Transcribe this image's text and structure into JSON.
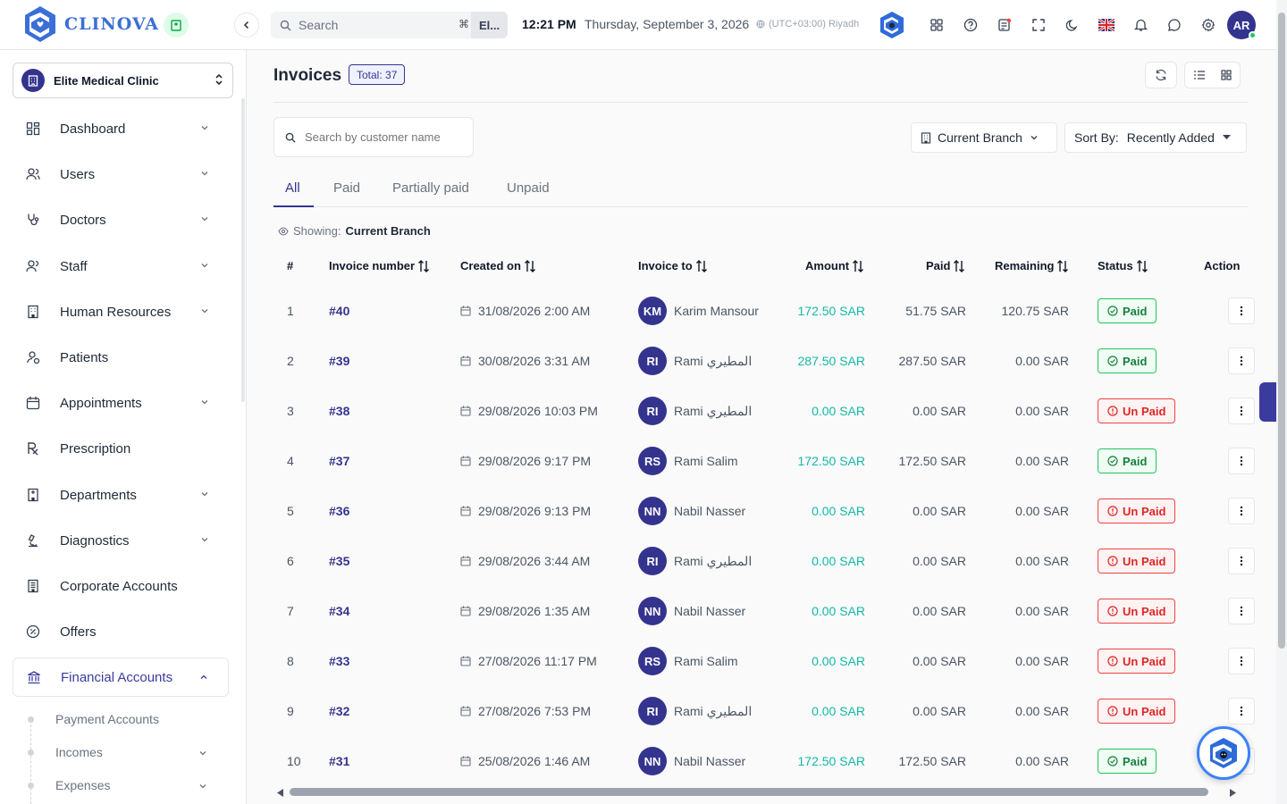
{
  "app": {
    "name": "CLINOVA"
  },
  "topbar": {
    "search_placeholder": "Search",
    "search_shortcut": "⌘",
    "workspace_short": "El...",
    "time": "12:21 PM",
    "date": "Thursday, September 3, 2026",
    "timezone": "(UTC+03:00) Riyadh",
    "user_initials": "AR"
  },
  "sidebar": {
    "clinic": "Elite Medical Clinic",
    "items": [
      {
        "label": "Dashboard",
        "icon": "dashboard-icon",
        "chevron": true
      },
      {
        "label": "Users",
        "icon": "users-icon",
        "chevron": true
      },
      {
        "label": "Doctors",
        "icon": "stethoscope-icon",
        "chevron": true
      },
      {
        "label": "Staff",
        "icon": "staff-icon",
        "chevron": true
      },
      {
        "label": "Human Resources",
        "icon": "building-icon",
        "chevron": true
      },
      {
        "label": "Patients",
        "icon": "patient-icon",
        "chevron": false
      },
      {
        "label": "Appointments",
        "icon": "calendar-icon",
        "chevron": true
      },
      {
        "label": "Prescription",
        "icon": "rx-icon",
        "chevron": false
      },
      {
        "label": "Departments",
        "icon": "department-icon",
        "chevron": true
      },
      {
        "label": "Diagnostics",
        "icon": "microscope-icon",
        "chevron": true
      },
      {
        "label": "Corporate Accounts",
        "icon": "corporate-icon",
        "chevron": false
      },
      {
        "label": "Offers",
        "icon": "offer-icon",
        "chevron": false
      },
      {
        "label": "Financial Accounts",
        "icon": "bank-icon",
        "chevron": true,
        "active": true
      }
    ],
    "sub_items": [
      "Payment Accounts",
      "Incomes",
      "Expenses"
    ]
  },
  "page": {
    "title": "Invoices",
    "total_badge": "Total: 37",
    "search_placeholder": "Search by customer name",
    "branch_dropdown": "Current Branch",
    "sort_label": "Sort By:",
    "sort_value": "Recently Added",
    "tabs": [
      "All",
      "Paid",
      "Partially paid",
      "Unpaid"
    ],
    "showing_label": "Showing:",
    "showing_value": "Current Branch"
  },
  "table": {
    "headers": [
      "#",
      "Invoice number",
      "Created on",
      "Invoice to",
      "Amount",
      "Paid",
      "Remaining",
      "Status",
      "Action"
    ],
    "rows": [
      {
        "idx": "1",
        "invoice": "#40",
        "date": "31/08/2026 2:00 AM",
        "initials": "KM",
        "customer": "Karim Mansour",
        "amount": "172.50 SAR",
        "paid": "51.75 SAR",
        "remaining": "120.75 SAR",
        "status": "Paid",
        "status_type": "paid"
      },
      {
        "idx": "2",
        "invoice": "#39",
        "date": "30/08/2026 3:31 AM",
        "initials": "RI",
        "customer": "Rami المطيري",
        "amount": "287.50 SAR",
        "paid": "287.50 SAR",
        "remaining": "0.00 SAR",
        "status": "Paid",
        "status_type": "paid"
      },
      {
        "idx": "3",
        "invoice": "#38",
        "date": "29/08/2026 10:03 PM",
        "initials": "RI",
        "customer": "Rami المطيري",
        "amount": "0.00 SAR",
        "paid": "0.00 SAR",
        "remaining": "0.00 SAR",
        "status": "Un Paid",
        "status_type": "unpaid"
      },
      {
        "idx": "4",
        "invoice": "#37",
        "date": "29/08/2026 9:17 PM",
        "initials": "RS",
        "customer": "Rami Salim",
        "amount": "172.50 SAR",
        "paid": "172.50 SAR",
        "remaining": "0.00 SAR",
        "status": "Paid",
        "status_type": "paid"
      },
      {
        "idx": "5",
        "invoice": "#36",
        "date": "29/08/2026 9:13 PM",
        "initials": "NN",
        "customer": "Nabil Nasser",
        "amount": "0.00 SAR",
        "paid": "0.00 SAR",
        "remaining": "0.00 SAR",
        "status": "Un Paid",
        "status_type": "unpaid"
      },
      {
        "idx": "6",
        "invoice": "#35",
        "date": "29/08/2026 3:44 AM",
        "initials": "RI",
        "customer": "Rami المطيري",
        "amount": "0.00 SAR",
        "paid": "0.00 SAR",
        "remaining": "0.00 SAR",
        "status": "Un Paid",
        "status_type": "unpaid"
      },
      {
        "idx": "7",
        "invoice": "#34",
        "date": "29/08/2026 1:35 AM",
        "initials": "NN",
        "customer": "Nabil Nasser",
        "amount": "0.00 SAR",
        "paid": "0.00 SAR",
        "remaining": "0.00 SAR",
        "status": "Un Paid",
        "status_type": "unpaid"
      },
      {
        "idx": "8",
        "invoice": "#33",
        "date": "27/08/2026 11:17 PM",
        "initials": "RS",
        "customer": "Rami Salim",
        "amount": "0.00 SAR",
        "paid": "0.00 SAR",
        "remaining": "0.00 SAR",
        "status": "Un Paid",
        "status_type": "unpaid"
      },
      {
        "idx": "9",
        "invoice": "#32",
        "date": "27/08/2026 7:53 PM",
        "initials": "RI",
        "customer": "Rami المطيري",
        "amount": "0.00 SAR",
        "paid": "0.00 SAR",
        "remaining": "0.00 SAR",
        "status": "Un Paid",
        "status_type": "unpaid"
      },
      {
        "idx": "10",
        "invoice": "#31",
        "date": "25/08/2026 1:46 AM",
        "initials": "NN",
        "customer": "Nabil Nasser",
        "amount": "172.50 SAR",
        "paid": "172.50 SAR",
        "remaining": "0.00 SAR",
        "status": "Paid",
        "status_type": "paid"
      }
    ]
  },
  "colors": {
    "primary": "#34348f",
    "teal": "#14b8a6",
    "paid_green": "#15803d",
    "unpaid_red": "#dc2626",
    "logo_blue": "#3b6fd6"
  }
}
